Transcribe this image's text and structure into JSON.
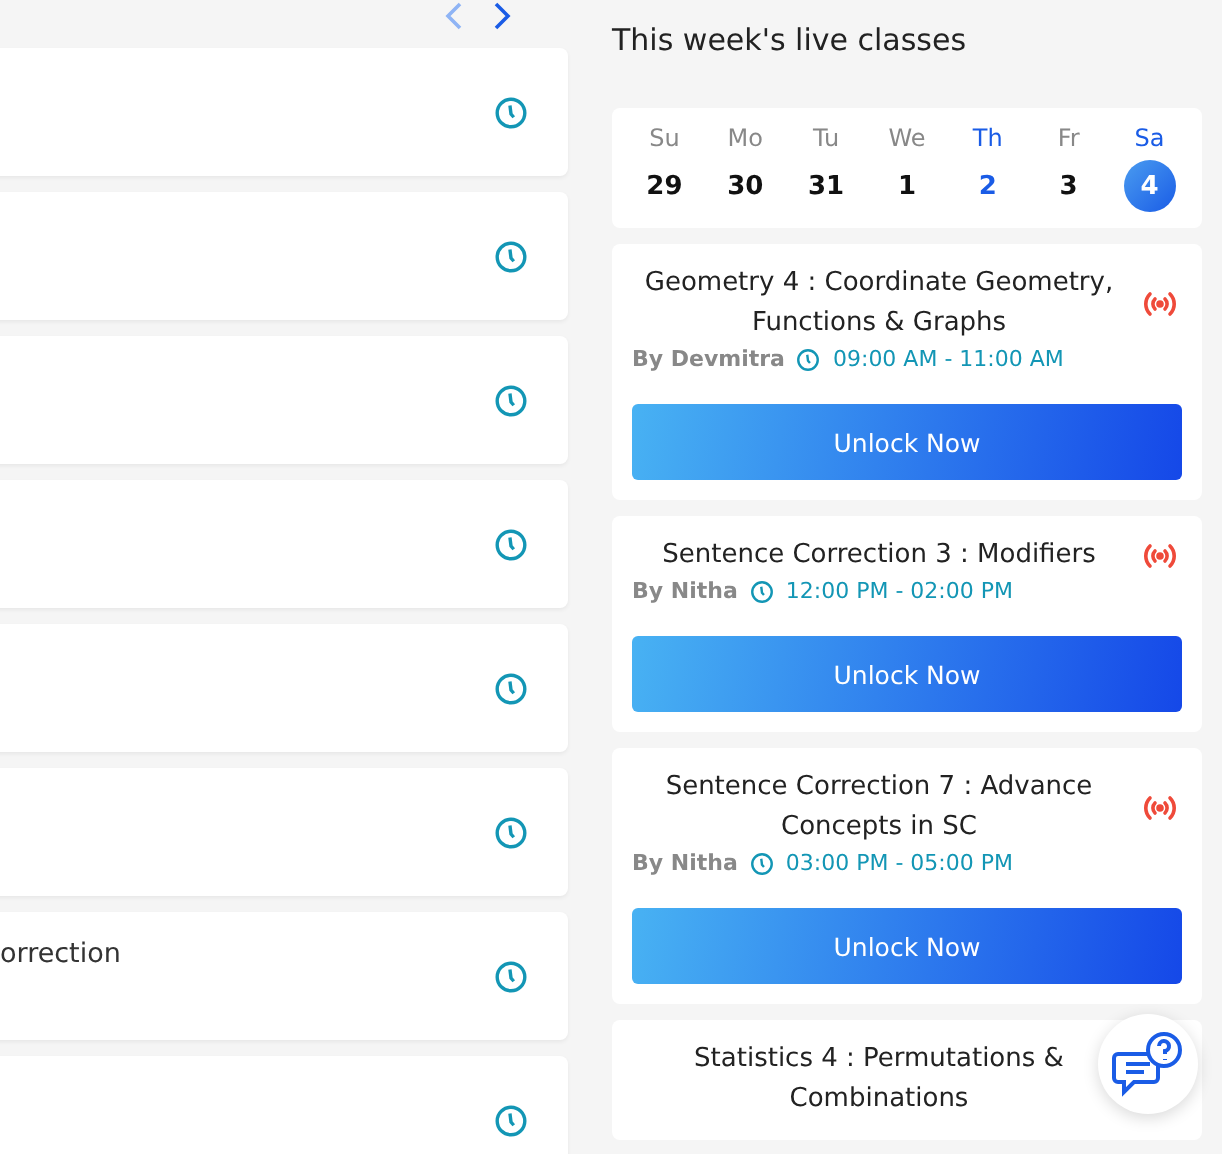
{
  "nav": {
    "prev_disabled": true,
    "next_disabled": false
  },
  "left_cards": [
    {
      "kind": "scheduled"
    },
    {
      "kind": "scheduled"
    },
    {
      "kind": "scheduled"
    },
    {
      "kind": "scheduled"
    },
    {
      "kind": "scheduled"
    },
    {
      "kind": "scheduled"
    },
    {
      "kind": "scheduled",
      "title": "orrection"
    },
    {
      "kind": "scheduled"
    }
  ],
  "live": {
    "title": "This week's live classes",
    "days": [
      {
        "name": "Su",
        "date": "29",
        "today": false,
        "selected": false
      },
      {
        "name": "Mo",
        "date": "30",
        "today": false,
        "selected": false
      },
      {
        "name": "Tu",
        "date": "31",
        "today": false,
        "selected": false
      },
      {
        "name": "We",
        "date": "1",
        "today": false,
        "selected": false
      },
      {
        "name": "Th",
        "date": "2",
        "today": true,
        "selected": false
      },
      {
        "name": "Fr",
        "date": "3",
        "today": false,
        "selected": false
      },
      {
        "name": "Sa",
        "date": "4",
        "today": false,
        "selected": true
      }
    ],
    "classes": [
      {
        "title": "Geometry 4 : Coordinate Geometry, Functions & Graphs",
        "by": "By Devmitra",
        "time": "09:00 AM - 11:00 AM",
        "button": "Unlock Now"
      },
      {
        "title": "Sentence Correction 3 : Modifiers",
        "by": "By Nitha",
        "time": "12:00 PM - 02:00 PM",
        "button": "Unlock Now"
      },
      {
        "title": "Sentence Correction 7 : Advance Concepts in SC",
        "by": "By Nitha",
        "time": "03:00 PM - 05:00 PM",
        "button": "Unlock Now"
      },
      {
        "title": "Statistics 4 : Permutations & Combinations"
      }
    ]
  }
}
